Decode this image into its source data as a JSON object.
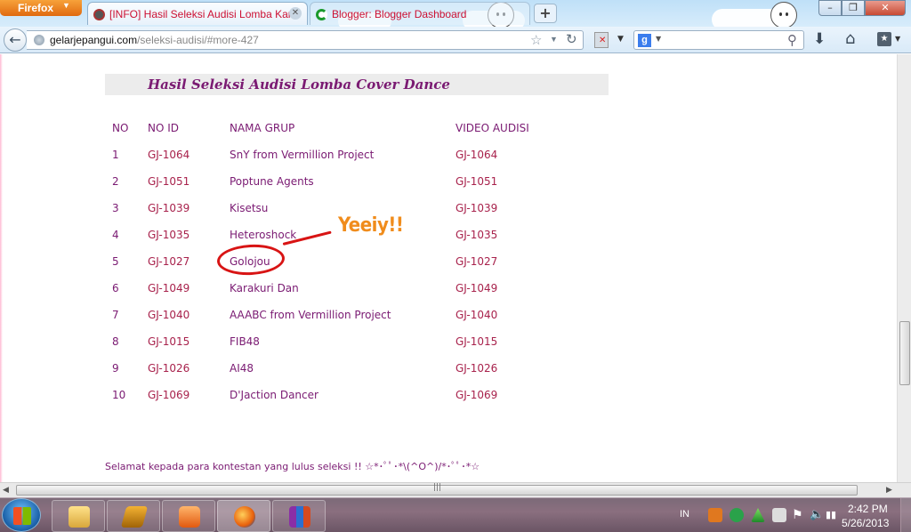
{
  "browser": {
    "menu_button_label": "Firefox",
    "tabs": [
      {
        "label": "[INFO] Hasil Seleksi Audisi Lomba Kar..."
      },
      {
        "label": "Blogger: Blogger Dashboard"
      }
    ],
    "url": {
      "domain": "gelarjepangui.com",
      "path": "/seleksi-audisi/#more-427"
    },
    "search_engine_letter": "g"
  },
  "page": {
    "title": "Hasil Seleksi Audisi Lomba Cover Dance",
    "table": {
      "headers": [
        "NO",
        "NO ID",
        "NAMA GRUP",
        "VIDEO AUDISI"
      ],
      "rows": [
        {
          "no": "1",
          "id": "GJ-1064",
          "group": "SnY from Vermillion Project",
          "video": "GJ-1064"
        },
        {
          "no": "2",
          "id": "GJ-1051",
          "group": "Poptune Agents",
          "video": "GJ-1051"
        },
        {
          "no": "3",
          "id": "GJ-1039",
          "group": "Kisetsu",
          "video": "GJ-1039"
        },
        {
          "no": "4",
          "id": "GJ-1035",
          "group": "Heteroshock",
          "video": "GJ-1035"
        },
        {
          "no": "5",
          "id": "GJ-1027",
          "group": "Golojou",
          "video": "GJ-1027"
        },
        {
          "no": "6",
          "id": "GJ-1049",
          "group": "Karakuri Dan",
          "video": "GJ-1049"
        },
        {
          "no": "7",
          "id": "GJ-1040",
          "group": "AAABC from Vermillion Project",
          "video": "GJ-1040"
        },
        {
          "no": "8",
          "id": "GJ-1015",
          "group": "FIB48",
          "video": "GJ-1015"
        },
        {
          "no": "9",
          "id": "GJ-1026",
          "group": "AI48",
          "video": "GJ-1026"
        },
        {
          "no": "10",
          "id": "GJ-1069",
          "group": "D'Jaction Dancer",
          "video": "GJ-1069"
        }
      ]
    },
    "annotation_text": "Yeeiy!!",
    "footer_text": "Selamat kepada para kontestan yang lulus seleksi !! ☆*･ﾟﾟ･*\\(^O^)/*･ﾟﾟ･*☆"
  },
  "taskbar": {
    "language": "IN",
    "time": "2:42 PM",
    "date": "5/26/2013"
  },
  "colors": {
    "text_purple": "#7a1a72",
    "link_red": "#a8224c",
    "annotation_red": "#d81414",
    "annotation_orange": "#f08c1c",
    "heading_bg": "#ececec"
  }
}
